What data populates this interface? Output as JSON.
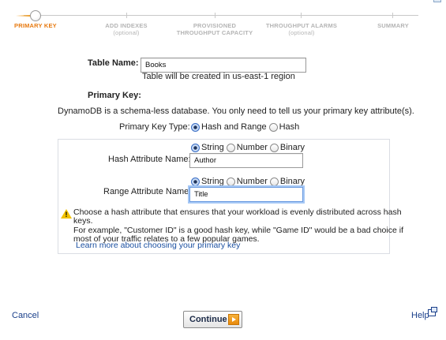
{
  "wizard": {
    "steps": [
      {
        "label": "PRIMARY KEY",
        "sub": ""
      },
      {
        "label": "ADD INDEXES",
        "sub": "(optional)"
      },
      {
        "label": "PROVISIONED",
        "sub": "THROUGHPUT CAPACITY"
      },
      {
        "label": "THROUGHPUT ALARMS",
        "sub": "(optional)"
      },
      {
        "label": "SUMMARY",
        "sub": ""
      }
    ]
  },
  "table_name": {
    "label": "Table Name:",
    "value": "Books",
    "note": "Table will be created in us-east-1 region"
  },
  "primary_key": {
    "heading": "Primary Key:",
    "description": "DynamoDB is a schema-less database. You only need to tell us your primary key attribute(s).",
    "type_label": "Primary Key Type:",
    "type_options": [
      "Hash and Range",
      "Hash"
    ],
    "type_selected": "Hash and Range"
  },
  "hash_attribute": {
    "label": "Hash Attribute Name:",
    "types": [
      "String",
      "Number",
      "Binary"
    ],
    "selected_type": "String",
    "value": "Author"
  },
  "range_attribute": {
    "label": "Range Attribute Name:",
    "types": [
      "String",
      "Number",
      "Binary"
    ],
    "selected_type": "String",
    "value": "Title"
  },
  "warning": {
    "icon": "warning-icon",
    "line1": "Choose a hash attribute that ensures that your workload is evenly distributed across hash",
    "line2": "keys.",
    "line3": "For example, \"Customer ID\" is a good hash key, while \"Game ID\" would be a bad choice if",
    "line4": "most of your traffic relates to a few popular games.",
    "link": "Learn more about choosing your primary key"
  },
  "footer": {
    "cancel": "Cancel",
    "continue": "Continue",
    "help": "Help"
  },
  "colors": {
    "accent": "#e77a10",
    "link": "#1a4fa0",
    "focus": "#a6c8f5"
  }
}
